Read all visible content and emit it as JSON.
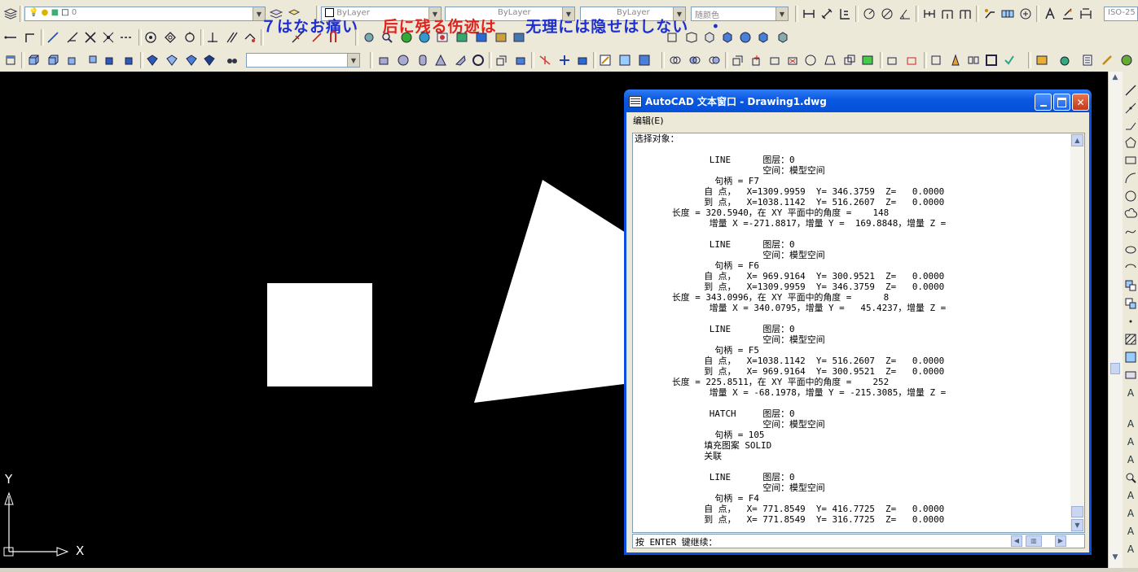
{
  "toolbar": {
    "layer_combo": "0",
    "color_combo": "ByLayer",
    "linetype_combo": "ByLayer",
    "lineweight_combo": "ByLayer",
    "plotstyle_combo": "随颜色",
    "dimstyle_combo": "ISO-25",
    "overlay_text_blue_1": "７はなお痛い",
    "overlay_text_red": "后に残る伤迹は",
    "overlay_text_blue_2": "无理には隐せはしない",
    "overlay_text_end": "・",
    "row1_icons": [
      "layers-icon",
      "lightbulb-icon",
      "sun-icon",
      "lock-icon",
      "color-swatch-icon"
    ],
    "row2_icons": [
      "line-icon",
      "construction-line-icon",
      "polyline-icon",
      "trim-icon",
      "extend-icon",
      "circle-icon",
      "rotate-icon",
      "measure-icon",
      "point-icon",
      "hatch-icon"
    ],
    "row3_icons": [
      "ucs-icon",
      "box-icon",
      "wedge-icon",
      "cylinder-icon",
      "sphere-icon",
      "cone-icon",
      "torus-icon",
      "render-icon",
      "material-icon"
    ]
  },
  "canvas": {
    "background": "#000000",
    "ucs_y_label": "Y",
    "ucs_x_label": "X"
  },
  "text_window": {
    "title": "AutoCAD 文本窗口 - Drawing1.dwg",
    "menu_edit": "编辑(E)",
    "log_lines": [
      "选择对象：",
      "",
      "              LINE      图层：0",
      "                        空间：模型空间",
      "               句柄 = F7",
      "             自 点，  X=1309.9959  Y= 346.3759  Z=   0.0000",
      "             到 点，  X=1038.1142  Y= 516.2607  Z=   0.0000",
      "       长度 = 320.5940，在 XY 平面中的角度 =    148",
      "              增量 X =-271.8817，增量 Y =  169.8848，增量 Z =",
      "",
      "              LINE      图层：0",
      "                        空间：模型空间",
      "               句柄 = F6",
      "             自 点，  X= 969.9164  Y= 300.9521  Z=   0.0000",
      "             到 点，  X=1309.9959  Y= 346.3759  Z=   0.0000",
      "       长度 = 343.0996，在 XY 平面中的角度 =      8",
      "              增量 X = 340.0795，增量 Y =   45.4237，增量 Z =",
      "",
      "              LINE      图层：0",
      "                        空间：模型空间",
      "               句柄 = F5",
      "             自 点，  X=1038.1142  Y= 516.2607  Z=   0.0000",
      "             到 点，  X= 969.9164  Y= 300.9521  Z=   0.0000",
      "       长度 = 225.8511，在 XY 平面中的角度 =    252",
      "              增量 X = -68.1978，增量 Y = -215.3085，增量 Z =",
      "",
      "              HATCH     图层：0",
      "                        空间：模型空间",
      "               句柄 = 105",
      "             填充图案 SOLID",
      "             关联",
      "",
      "              LINE      图层：0",
      "                        空间：模型空间",
      "               句柄 = F4",
      "             自 点，  X= 771.8549  Y= 416.7725  Z=   0.0000",
      "             到 点，  X= 771.8549  Y= 316.7725  Z=   0.0000"
    ],
    "command_prompt": "按 ENTER 键继续："
  }
}
